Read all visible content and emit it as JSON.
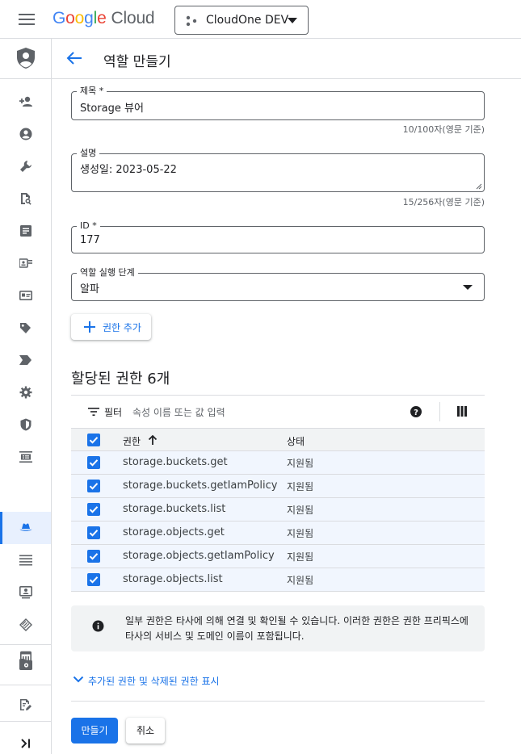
{
  "app": {
    "logo_letters": [
      "G",
      "o",
      "o",
      "g",
      "l",
      "e"
    ],
    "logo_suffix": "Cloud",
    "project_name": "CloudOne DEV"
  },
  "header": {
    "title": "역할 만들기"
  },
  "rail": {
    "items": [
      "person-add-icon",
      "account-circle-icon",
      "wrench-icon",
      "document-search-icon",
      "article-icon",
      "service-account-icon",
      "id-card-icon",
      "label-tag-icon",
      "label-arrow-icon",
      "settings-gear-icon",
      "security-shield-icon",
      "list-box-icon",
      "roles-hat-icon",
      "list-lines-icon",
      "identity-frame-icon",
      "stack-diamond-icon",
      "calendar-grid-icon",
      "folder-settings-icon",
      "edit-note-icon",
      "expand-rail-icon"
    ],
    "active_item": "roles-hat-icon"
  },
  "form": {
    "title_field": {
      "label": "제목 *",
      "value": "Storage 뷰어",
      "counter": "10/100자(영문 기준)"
    },
    "description_field": {
      "label": "설명",
      "value": "생성일: 2023-05-22",
      "counter": "15/256자(영문 기준)"
    },
    "id_field": {
      "label": "ID *",
      "value": "177"
    },
    "stage_field": {
      "label": "역할 실행 단계",
      "value": "알파"
    },
    "add_permission_label": "권한 추가"
  },
  "permissions": {
    "section_title": "할당된 권한 6개",
    "filter_label": "필터",
    "filter_placeholder": "속성 이름 또는 값 입력",
    "columns": {
      "name": "권한",
      "status": "상태"
    },
    "rows": [
      {
        "name": "storage.buckets.get",
        "status": "지원됨",
        "checked": true
      },
      {
        "name": "storage.buckets.getIamPolicy",
        "status": "지원됨",
        "checked": true
      },
      {
        "name": "storage.buckets.list",
        "status": "지원됨",
        "checked": true
      },
      {
        "name": "storage.objects.get",
        "status": "지원됨",
        "checked": true
      },
      {
        "name": "storage.objects.getIamPolicy",
        "status": "지원됨",
        "checked": true
      },
      {
        "name": "storage.objects.list",
        "status": "지원됨",
        "checked": true
      }
    ]
  },
  "info": {
    "text": "일부 권한은 타사에 의해 연결 및 확인될 수 있습니다. 이러한 권한은 권한 프리픽스에 타사의 서비스 및 도메인 이름이 포함됩니다."
  },
  "show_toggle_label": "추가된 권한 및 삭제된 권한 표시",
  "actions": {
    "create_label": "만들기",
    "cancel_label": "취소"
  },
  "colors": {
    "accent": "#1a73e8",
    "row_highlight": "#f1f6fe",
    "icon_gray": "#5f6368"
  }
}
